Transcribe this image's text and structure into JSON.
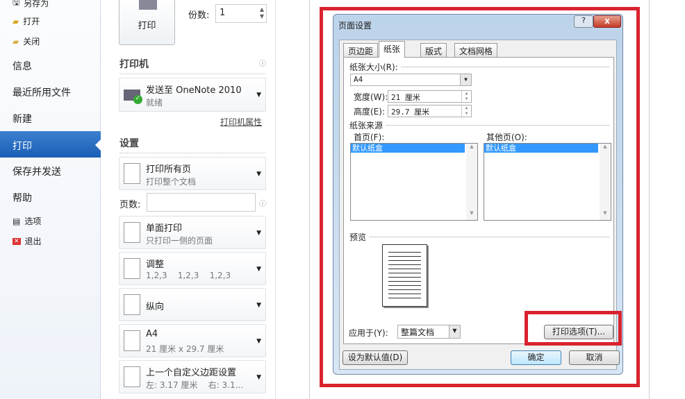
{
  "sidebar": {
    "small_top": [
      {
        "label": "另存为",
        "icon": "save-as-icon"
      },
      {
        "label": "打开",
        "icon": "folder-open-icon"
      },
      {
        "label": "关闭",
        "icon": "folder-close-icon"
      }
    ],
    "items": [
      "信息",
      "最近所用文件",
      "新建",
      "打印",
      "保存并发送",
      "帮助"
    ],
    "small_bottom": [
      {
        "label": "选项",
        "icon": "options-icon"
      },
      {
        "label": "退出",
        "icon": "exit-icon"
      }
    ]
  },
  "print": {
    "button": "打印",
    "copies_label": "份数:",
    "copies_value": "1",
    "printer_header": "打印机",
    "printer_name": "发送至 OneNote 2010",
    "printer_status": "就绪",
    "printer_props": "打印机属性",
    "settings_header": "设置",
    "settings": [
      {
        "t1": "打印所有页",
        "t2": "打印整个文档"
      },
      {
        "t1": "单面打印",
        "t2": "只打印一侧的页面"
      },
      {
        "t1": "调整",
        "t2": "1,2,3    1,2,3    1,2,3"
      },
      {
        "t1": "纵向",
        "t2": ""
      },
      {
        "t1": "A4",
        "t2": "21 厘米 x 29.7 厘米"
      },
      {
        "t1": "上一个自定义边距设置",
        "t2": "左: 3.17 厘米    右: 3.1..."
      }
    ],
    "pages_label": "页数:",
    "pages_value": ""
  },
  "dialog": {
    "title": "页面设置",
    "help": "?",
    "close": "x",
    "tabs": [
      "页边距",
      "纸张",
      "版式",
      "文档网格"
    ],
    "paper_size_label": "纸张大小(R):",
    "paper_size": "A4",
    "width_label": "宽度(W):",
    "width_value": "21 厘米",
    "height_label": "高度(E):",
    "height_value": "29.7 厘米",
    "source_label": "纸张来源",
    "first_page_label": "首页(F):",
    "other_pages_label": "其他页(O):",
    "first_page_item": "默认纸盒",
    "other_pages_item": "默认纸盒",
    "preview_label": "预览",
    "apply_label": "应用于(Y):",
    "apply_value": "整篇文档",
    "print_options": "打印选项(T)...",
    "set_default": "设为默认值(D)",
    "ok": "确定",
    "cancel": "取消"
  },
  "colors": {
    "accent": "#1a5fb4",
    "highlight": "#d9232d"
  }
}
